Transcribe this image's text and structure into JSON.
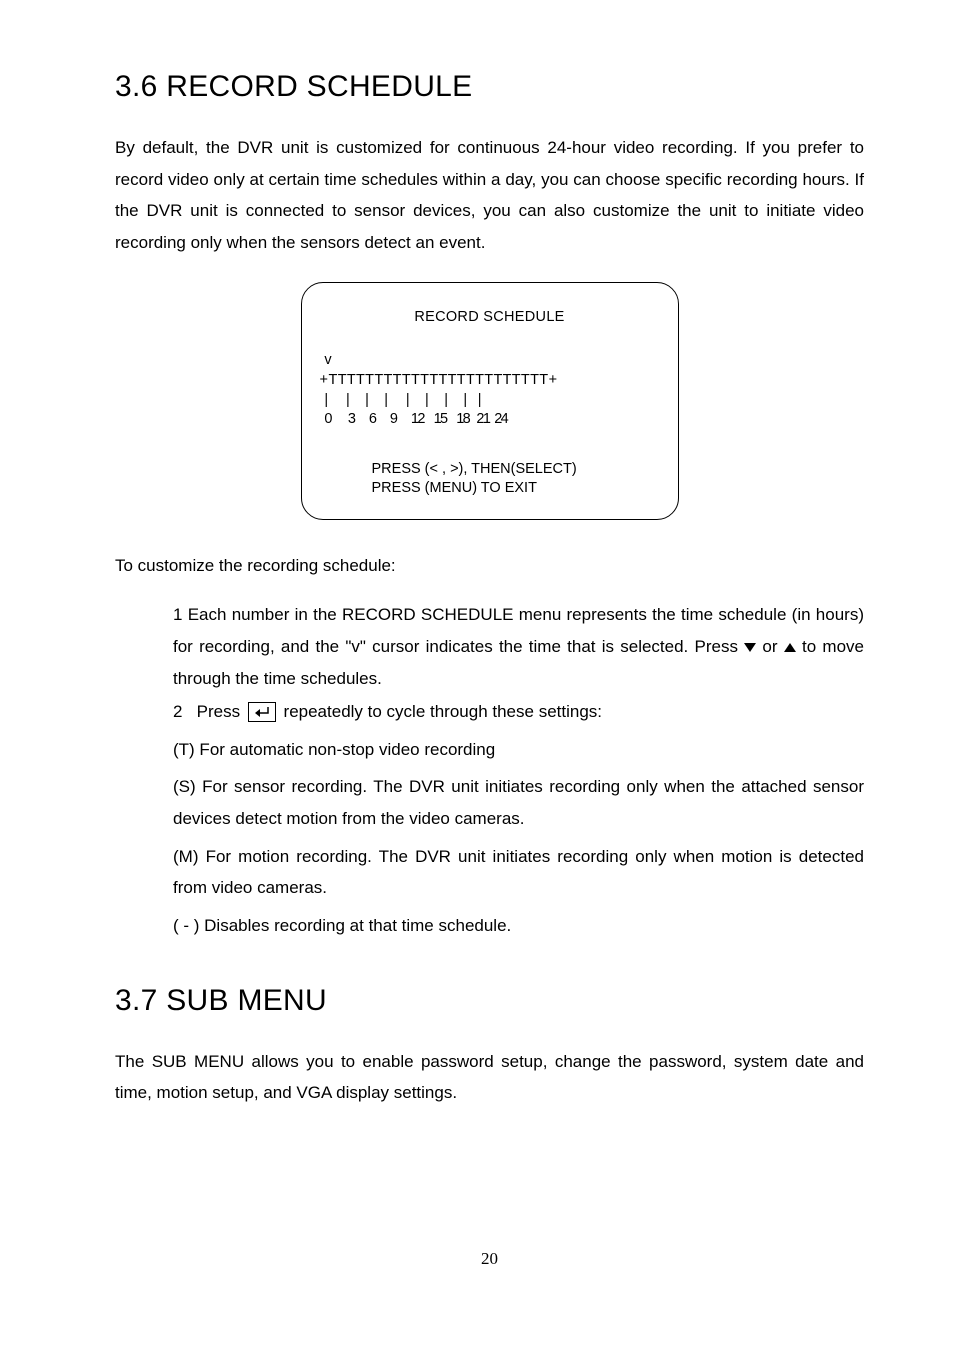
{
  "section1": {
    "heading": "3.6  RECORD SCHEDULE",
    "intro": "By default, the DVR unit is customized for continuous 24-hour video recording. If you prefer to record video only at certain time schedules within a day, you can choose specific recording hours. If the DVR unit is connected to sensor devices, you can also customize the unit to initiate video recording only when the sensors detect an event.",
    "scheduleBox": {
      "title": "RECORD SCHEDULE",
      "cursorLine": "  v",
      "barLine": "+ T T T T T T T T T T T T T T T T T T T T T T T T +",
      "tickLine": "  |        |       |       |        |       |       |       |     |",
      "numLine": "  0       3      6      9      12    15    18   21  24",
      "footer1": "PRESS (< , >), THEN(SELECT)",
      "footer2": "PRESS (MENU) TO EXIT"
    },
    "customizeLead": "To customize the recording schedule:",
    "step1": "1  Each number in the RECORD SCHEDULE menu represents the time schedule (in hours) for recording, and the \"v\" cursor indicates the time that is selected. Press ",
    "step1_mid": " or ",
    "step1_end": " to move through the time schedules.",
    "step2_pre": "2   Press ",
    "step2_post": " repeatedly to cycle through these settings:",
    "optT": "(T) For automatic non-stop video recording",
    "optS": "(S) For sensor recording. The DVR unit initiates recording only when the attached sensor devices detect motion from the video cameras.",
    "optM": "(M) For motion recording. The DVR unit initiates recording only when motion is detected from video cameras.",
    "optDash": "( - ) Disables recording at that time schedule."
  },
  "section2": {
    "heading": "3.7  SUB MENU",
    "body": "The SUB MENU allows you to enable password setup, change the password, system date and time, motion setup, and VGA display settings."
  },
  "pageNumber": "20"
}
